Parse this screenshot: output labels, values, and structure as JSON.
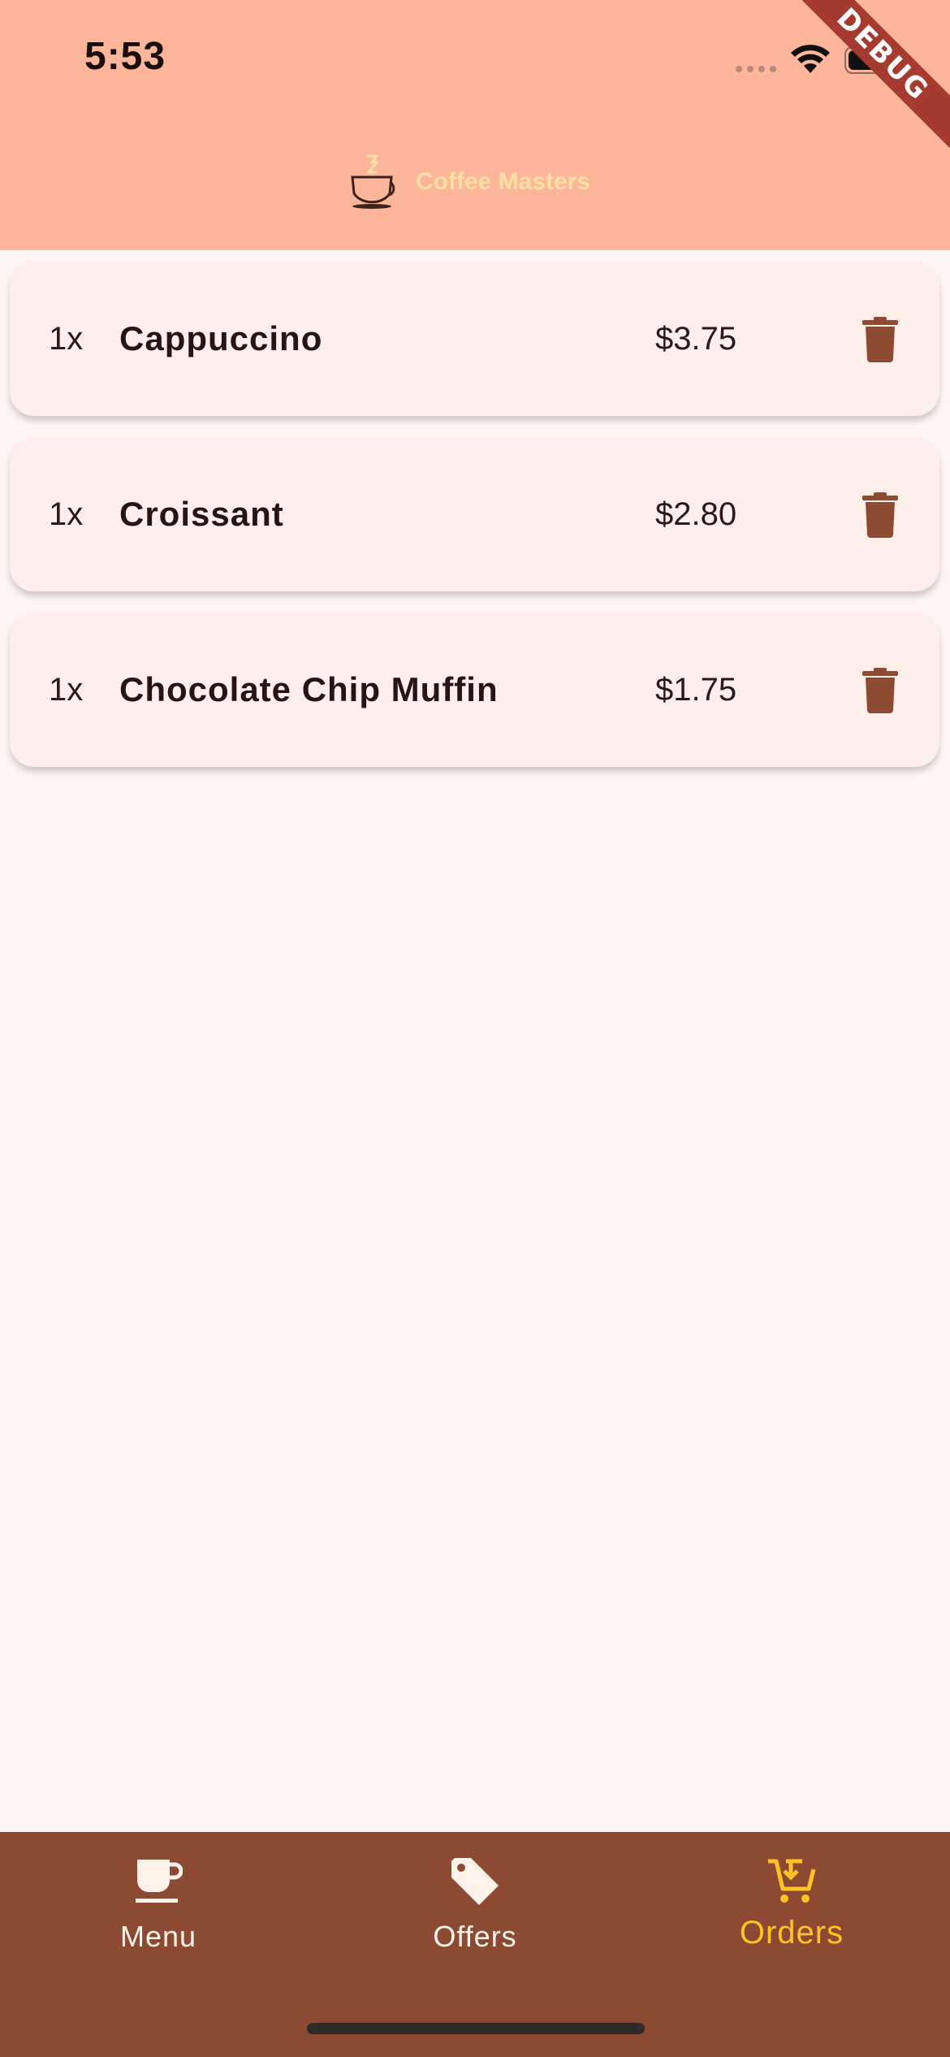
{
  "status_bar": {
    "time": "5:53"
  },
  "debug_banner": "DEBUG",
  "header": {
    "title": "Coffee Masters",
    "logo_icon": "coffee-cup-icon"
  },
  "orders": [
    {
      "quantity": "1x",
      "name": "Cappuccino",
      "price": "$3.75"
    },
    {
      "quantity": "1x",
      "name": "Croissant",
      "price": "$2.80"
    },
    {
      "quantity": "1x",
      "name": "Chocolate Chip Muffin",
      "price": "$1.75"
    }
  ],
  "nav": {
    "items": [
      {
        "label": "Menu",
        "icon": "coffee-cup-icon"
      },
      {
        "label": "Offers",
        "icon": "tag-icon"
      },
      {
        "label": "Orders",
        "icon": "cart-icon"
      }
    ],
    "active": "Orders"
  },
  "colors": {
    "appbar": "#FFB59A",
    "background": "#FFF5F3",
    "card": "#FFEFEB",
    "accent_brown": "#8C4A33",
    "active_yellow": "#FFC424",
    "logo_text": "#FFE1A6"
  }
}
